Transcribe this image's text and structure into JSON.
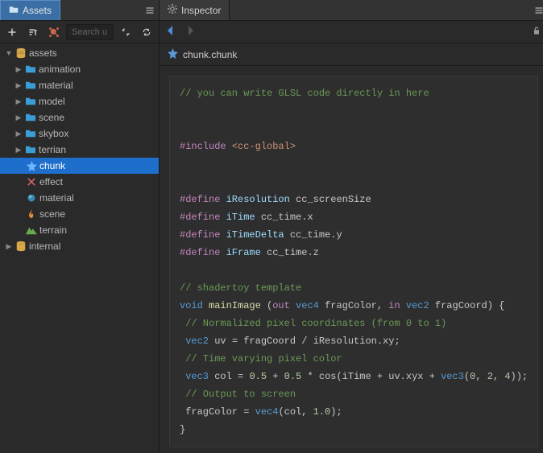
{
  "left": {
    "tab": "Assets",
    "search_placeholder": "Search u",
    "tree": {
      "assets": "assets",
      "folders": [
        "animation",
        "material",
        "model",
        "scene",
        "skybox",
        "terrian"
      ],
      "items": [
        {
          "label": "chunk",
          "icon": "star",
          "selected": true
        },
        {
          "label": "effect",
          "icon": "plus4",
          "selected": false
        },
        {
          "label": "material",
          "icon": "sphere",
          "selected": false
        },
        {
          "label": "scene",
          "icon": "flame",
          "selected": false
        },
        {
          "label": "terrain",
          "icon": "mountain",
          "selected": false
        }
      ],
      "internal": "internal"
    }
  },
  "right": {
    "tab": "Inspector",
    "filename": "chunk.chunk"
  },
  "code": {
    "c1": "// you can write GLSL code directly in here",
    "inc": "#include ",
    "inc_arg": "<cc-global>",
    "d1a": "#define ",
    "d1b": "iResolution ",
    "d1c": "cc_screenSize",
    "d2a": "#define ",
    "d2b": "iTime ",
    "d2c": "cc_time.x",
    "d3a": "#define ",
    "d3b": "iTimeDelta ",
    "d3c": "cc_time.y",
    "d4a": "#define ",
    "d4b": "iFrame ",
    "d4c": "cc_time.z",
    "c2": "// shadertoy template",
    "fn_kw": "void ",
    "fn_name": "mainImage ",
    "fn_open": "(",
    "fn_out": "out ",
    "fn_t1": "vec4 ",
    "fn_p1": "fragColor, ",
    "fn_in": "in ",
    "fn_t2": "vec2 ",
    "fn_p2": "fragCoord",
    "fn_close": ") {",
    "c3": " // Normalized pixel coordinates (from 0 to 1)",
    "l1_t": " vec2 ",
    "l1_b": "uv = fragCoord / iResolution.xy;",
    "c4": " // Time varying pixel color",
    "l2_t": " vec3 ",
    "l2_a": "col = ",
    "l2_n1": "0.5",
    "l2_b": " + ",
    "l2_n2": "0.5",
    "l2_c": " * cos(iTime + uv.xyx + ",
    "l2_t2": "vec3",
    "l2_d": "(",
    "l2_n3": "0",
    "l2_e": ", ",
    "l2_n4": "2",
    "l2_f": ", ",
    "l2_n5": "4",
    "l2_g": "));",
    "c5": " // Output to screen",
    "l3_a": " fragColor = ",
    "l3_t": "vec4",
    "l3_b": "(col, ",
    "l3_n": "1.0",
    "l3_c": ");",
    "close": "}"
  }
}
